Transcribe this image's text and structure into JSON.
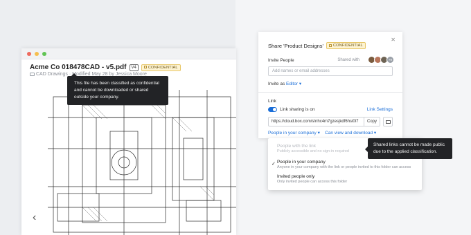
{
  "file": {
    "title": "Acme Co 018478CAD - v5.pdf",
    "version": "V4",
    "classification": "CONFIDENTIAL",
    "breadcrumb": "CAD Drawings · Modified May 28 by Jessica Moore",
    "tooltip": "This file has been classified as confidential and cannot be downloaded or shared outside your company.",
    "prev_icon": "chevron-left-icon"
  },
  "share": {
    "title": "Share 'Product Designs'",
    "classification": "CONFIDENTIAL",
    "close_icon": "close-icon",
    "invite_label": "Invite People",
    "shared_with_label": "Shared with",
    "avatars_more": "+9",
    "invite_placeholder": "Add names or email addresses",
    "invite_as_label": "Invite as",
    "invite_as_role": "Editor",
    "link_label": "Link",
    "link_settings": "Link Settings",
    "link_sharing_status": "Link sharing is on",
    "link_sharing_enabled": true,
    "url": "https://cloud.box.com/s/nhc4m7gzesjkdf6hsi0l7",
    "copy_label": "Copy",
    "mail_icon": "mail-icon",
    "audience_selected": "People in your company",
    "permission_selected": "Can view and download"
  },
  "audience_menu": {
    "options": [
      {
        "title": "People with the link",
        "subtitle": "Publicly accessible and no sign-in required",
        "disabled": true,
        "selected": false
      },
      {
        "title": "People in your company",
        "subtitle": "Anyone in your company with the link or people invited to this folder can access",
        "disabled": false,
        "selected": true
      },
      {
        "title": "Invited people only",
        "subtitle": "Only invited people can access this folder",
        "disabled": false,
        "selected": false
      }
    ],
    "tooltip": "Shared links cannot be made public due to the applied classification."
  },
  "colors": {
    "accent": "#1a6ed8",
    "confidential_bg": "#fdf3d2",
    "tooltip_bg": "#222326"
  }
}
